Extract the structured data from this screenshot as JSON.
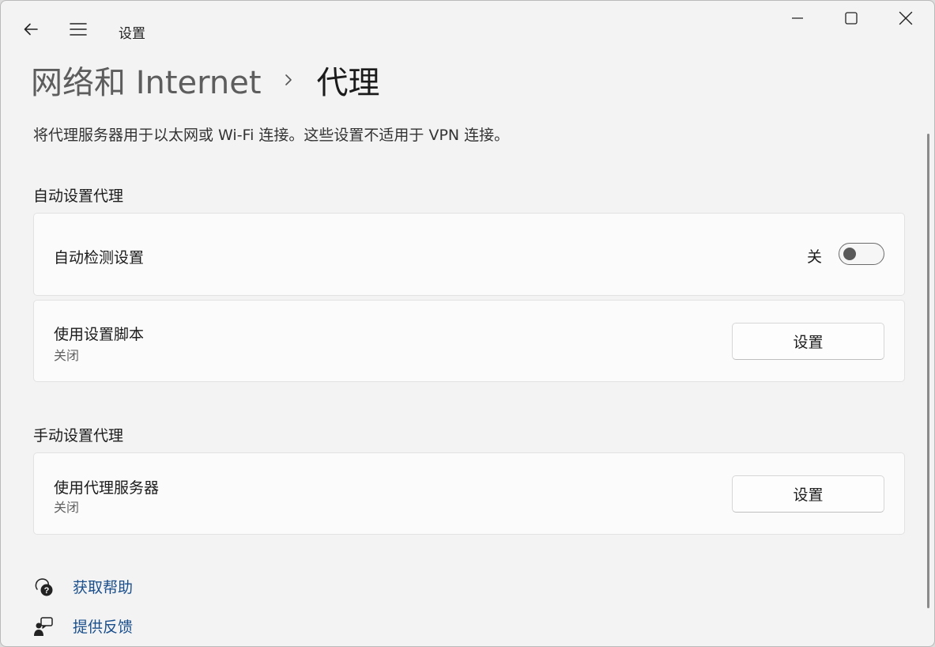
{
  "app": {
    "title": "设置"
  },
  "breadcrumb": {
    "parent": "网络和 Internet",
    "separator": "›",
    "current": "代理"
  },
  "description": "将代理服务器用于以太网或 Wi-Fi 连接。这些设置不适用于 VPN 连接。",
  "auto_section": {
    "title": "自动设置代理",
    "detect": {
      "label": "自动检测设置",
      "state_label": "关",
      "enabled": false
    },
    "script": {
      "label": "使用设置脚本",
      "status": "关闭",
      "button_label": "设置"
    }
  },
  "manual_section": {
    "title": "手动设置代理",
    "proxy_server": {
      "label": "使用代理服务器",
      "status": "关闭",
      "button_label": "设置"
    }
  },
  "links": {
    "help": "获取帮助",
    "feedback": "提供反馈"
  },
  "colors": {
    "link": "#1a4f8c",
    "background": "#f3f3f3",
    "card": "#fbfbfb"
  }
}
